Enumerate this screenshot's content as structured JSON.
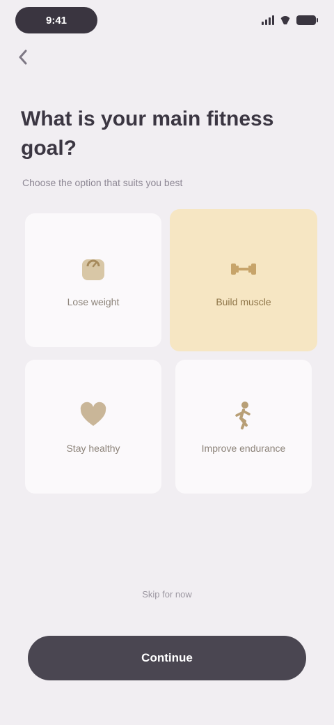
{
  "status_bar": {
    "time": "9:41",
    "signal_icon": "signal-icon",
    "wifi_icon": "wifi-icon",
    "battery_icon": "battery-icon"
  },
  "nav": {
    "back_icon": "chevron-left-icon"
  },
  "header": {
    "title": "What is your main fitness goal?",
    "subtitle": "Choose the option that suits you best"
  },
  "options": [
    {
      "label": "Lose weight",
      "icon": "scale-icon",
      "selected": false
    },
    {
      "label": "Build muscle",
      "icon": "dumbbell-icon",
      "selected": true
    },
    {
      "label": "Stay healthy",
      "icon": "heart-icon",
      "selected": false
    },
    {
      "label": "Improve endurance",
      "icon": "runner-icon",
      "selected": false
    }
  ],
  "footer": {
    "skip_label": "Skip for now",
    "continue_label": "Continue"
  },
  "colors": {
    "background": "#f1eef2",
    "card": "#fbf9fb",
    "card_selected": "#f6e6c3",
    "icon_tan": "#b8a17c",
    "button": "#4a4651"
  }
}
